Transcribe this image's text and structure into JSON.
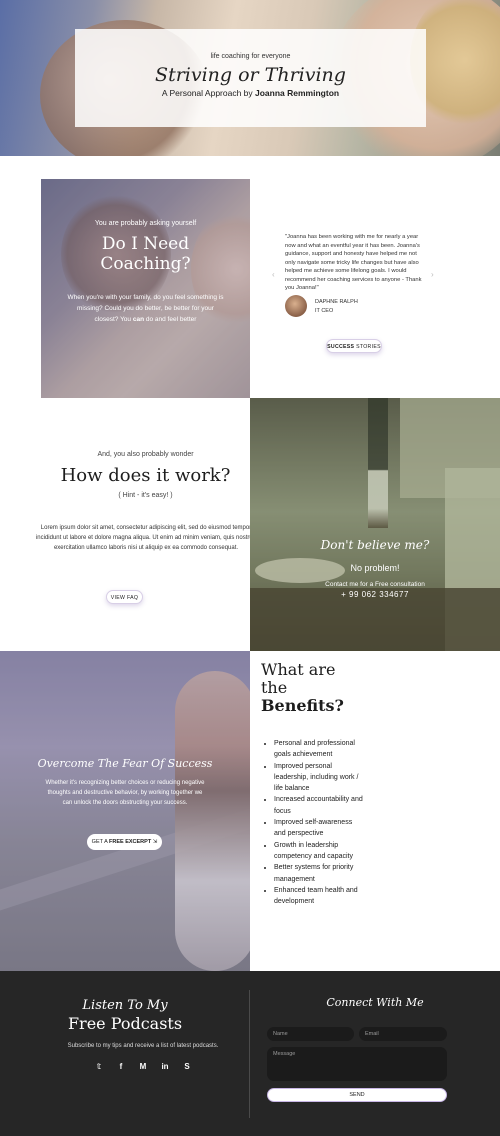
{
  "hero": {
    "tagline": "life coaching for everyone",
    "title": "Striving or Thriving",
    "subtitle_prefix": "A Personal Approach by ",
    "subtitle_name": "Joanna Remmington"
  },
  "coaching": {
    "small": "You are probably asking yourself",
    "title_line1": "Do I Need",
    "title_line2": "Coaching?",
    "body_prefix": "When you're with your family, do you feel something is missing? Could you do better, be better for your closest? You ",
    "body_bold": "can",
    "body_suffix": " do and feel better"
  },
  "testimonial": {
    "quote": "\"Joanna has been working with me for nearly a year now and what an eventful year it has been. Joanna's guidance, support and honesty have helped me not only navigate some tricky life changes but have also helped me achieve some lifelong goals. I would recommend her coaching services to anyone - Thank you Joanna!\"",
    "name": "DAPHNE RALPH",
    "role": "IT CEO",
    "prev_arrow": "‹",
    "next_arrow": "›",
    "button_bold": "SUCCESS",
    "button_rest": " STORIES"
  },
  "how": {
    "small": "And, you also probably wonder",
    "title": "How does it work?",
    "hint": "( Hint - it's easy! )",
    "body": "Lorem ipsum dolor sit amet, consectetur adipiscing elit, sed do eiusmod tempor incididunt ut labore et dolore magna aliqua. Ut enim ad minim veniam, quis nostrud exercitation ullamco laboris nisi ut aliquip ex ea commodo consequat.",
    "button": "VIEW FAQ"
  },
  "kitchen": {
    "title": "Don't believe me?",
    "sub": "No problem!",
    "contact": "Contact me for a Free consultation",
    "phone": "+ 99 062 334677"
  },
  "fear": {
    "title": "Overcome The Fear Of Success",
    "body": "Whether it's recognizing better choices or reducing negative thoughts and destructive behavior, by working together we can unlock the doors obstructing your success.",
    "button_prefix": "GET A ",
    "button_bold": "FREE EXCERPT",
    "button_icon": "⇲"
  },
  "benefits": {
    "title_line1": "What are",
    "title_line2": "the",
    "title_line3": "Benefits?",
    "items": [
      "Personal and professional goals achievement",
      "Improved personal leadership, including work / life balance",
      "Increased accountability and focus",
      "Improved self-awareness and perspective",
      "Growth in leadership competency and capacity",
      "Better systems for priority management",
      "Enhanced team health and development"
    ]
  },
  "footer": {
    "listen": "Listen To My",
    "podcasts": "Free Podcasts",
    "subscribe": "Subscribe to my tips and receive a list of latest podcasts.",
    "social": [
      {
        "icon": "twitter-icon",
        "glyph": "𝕥"
      },
      {
        "icon": "facebook-icon",
        "glyph": "f"
      },
      {
        "icon": "medium-icon",
        "glyph": "M"
      },
      {
        "icon": "linkedin-icon",
        "glyph": "in"
      },
      {
        "icon": "skype-icon",
        "glyph": "S"
      }
    ],
    "connect": "Connect With Me",
    "name_placeholder": "Name",
    "email_placeholder": "Email",
    "message_placeholder": "Message",
    "send": "SEND"
  },
  "colors": {
    "accent_border": "#c8b6e6",
    "footer_bg": "#262626",
    "input_bg": "#1b1b1b"
  }
}
